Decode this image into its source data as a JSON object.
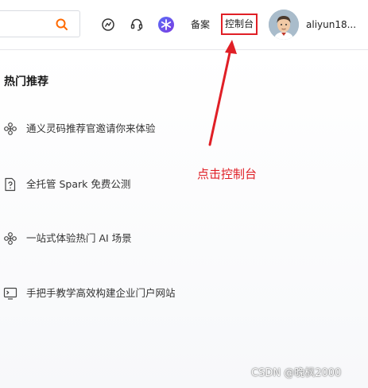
{
  "header": {
    "search_button_icon": "search-icon",
    "icons": [
      "ai-assistant-icon",
      "support-headset-icon",
      "qwen-icon"
    ],
    "filing_label": "备案",
    "console_label": "控制台",
    "username": "aliyun18...",
    "accent_color": "#ff6a00"
  },
  "panel": {
    "title": "热门推荐",
    "items": [
      {
        "icon": "network-nodes-icon",
        "label": "通义灵码推荐官邀请你来体验"
      },
      {
        "icon": "document-question-icon",
        "label": "全托管 Spark 免费公测"
      },
      {
        "icon": "network-nodes-icon",
        "label": "一站式体验热门 AI 场景"
      },
      {
        "icon": "monitor-terminal-icon",
        "label": "手把手教学高效构建企业门户网站"
      }
    ]
  },
  "annotation": {
    "text": "点击控制台",
    "color": "#e01f26"
  },
  "watermark": "CSDN @晚枫2000"
}
